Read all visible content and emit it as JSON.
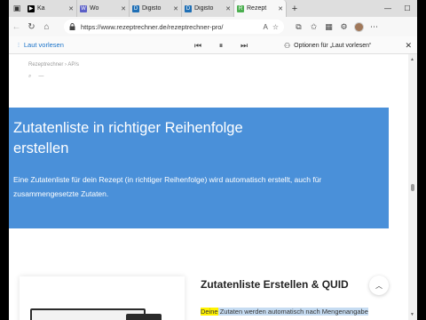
{
  "browser": {
    "tabs": [
      {
        "title": "Ka",
        "favicon_color": "#000000",
        "favicon_glyph": "▶",
        "active": false
      },
      {
        "title": "Wo",
        "favicon_color": "#5b5fc7",
        "favicon_glyph": "W",
        "active": false
      },
      {
        "title": "Digisto",
        "favicon_color": "#1f6fb5",
        "favicon_glyph": "D",
        "active": false
      },
      {
        "title": "Digisto",
        "favicon_color": "#1f6fb5",
        "favicon_glyph": "D",
        "active": false
      },
      {
        "title": "Rezept",
        "favicon_color": "#4caf50",
        "favicon_glyph": "R",
        "active": true
      }
    ],
    "url": "https://www.rezeptrechner.de/rezeptrechner-pro/",
    "read_aloud": {
      "label": "Laut vorlesen",
      "voice_options": "Optionen für „Laut vorlesen“"
    }
  },
  "page": {
    "breadcrumb": "Rezeptrechner › AP/s",
    "hero": {
      "title": "Zutatenliste in richtiger Reihenfolge erstellen",
      "text": "Eine Zutatenliste für dein Rezept (in richtiger Reihenfolge) wird automatisch erstellt, auch für zusammengesetzte Zutaten."
    },
    "section": {
      "title": "Zutatenliste Erstellen & QUID",
      "text_highlight_word": "Deine",
      "text_rest": " Zutaten werden automatisch nach Mengenangabe"
    }
  },
  "colors": {
    "hero_bg": "#4a90d9",
    "read_aloud_accent": "#1a73c9",
    "word_highlight": "#fff200",
    "sentence_highlight": "#c6dcf2"
  }
}
